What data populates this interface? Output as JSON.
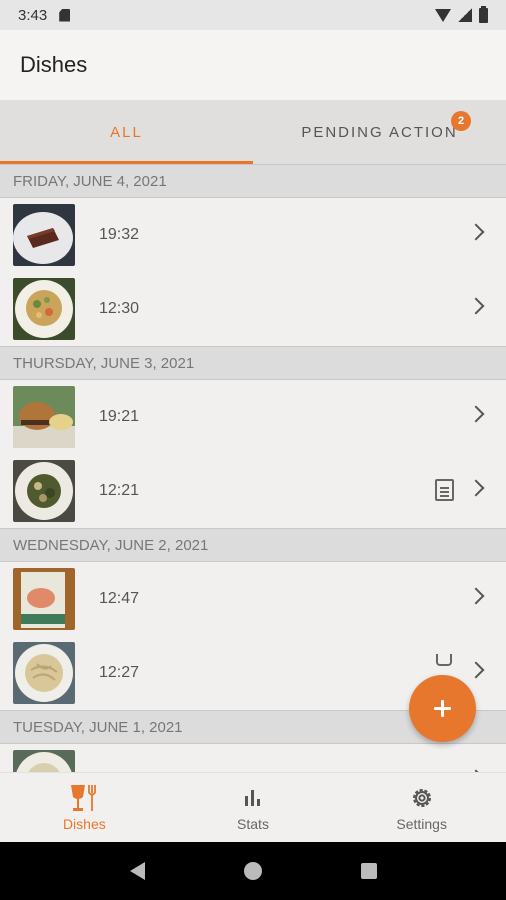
{
  "status_bar": {
    "time": "3:43"
  },
  "app_bar": {
    "title": "Dishes"
  },
  "tabs": {
    "all_label": "ALL",
    "pending_label": "PENDING ACTION",
    "pending_badge": "2"
  },
  "sections": [
    {
      "date": "FRIDAY, JUNE 4, 2021",
      "rows": [
        {
          "time": "19:32",
          "image": "dessert-cake-photo",
          "note": false,
          "cup": false
        },
        {
          "time": "12:30",
          "image": "salad-plate-photo",
          "note": false,
          "cup": false
        }
      ]
    },
    {
      "date": "THURSDAY, JUNE 3, 2021",
      "rows": [
        {
          "time": "19:21",
          "image": "burger-photo",
          "note": false,
          "cup": false
        },
        {
          "time": "12:21",
          "image": "greens-plate-photo",
          "note": true,
          "cup": false
        }
      ]
    },
    {
      "date": "WEDNESDAY, JUNE 2, 2021",
      "rows": [
        {
          "time": "12:47",
          "image": "packaged-salmon-photo",
          "note": false,
          "cup": false
        },
        {
          "time": "12:27",
          "image": "pasta-plate-photo",
          "note": false,
          "cup": true
        }
      ]
    },
    {
      "date": "TUESDAY, JUNE 1, 2021",
      "rows": [
        {
          "time": "",
          "image": "plate-photo",
          "note": false,
          "cup": false
        }
      ]
    }
  ],
  "bottom_nav": {
    "dishes_label": "Dishes",
    "stats_label": "Stats",
    "settings_label": "Settings"
  },
  "colors": {
    "accent": "#e8772e",
    "background": "#f2f0ef",
    "section_header": "#dcdcdc"
  }
}
